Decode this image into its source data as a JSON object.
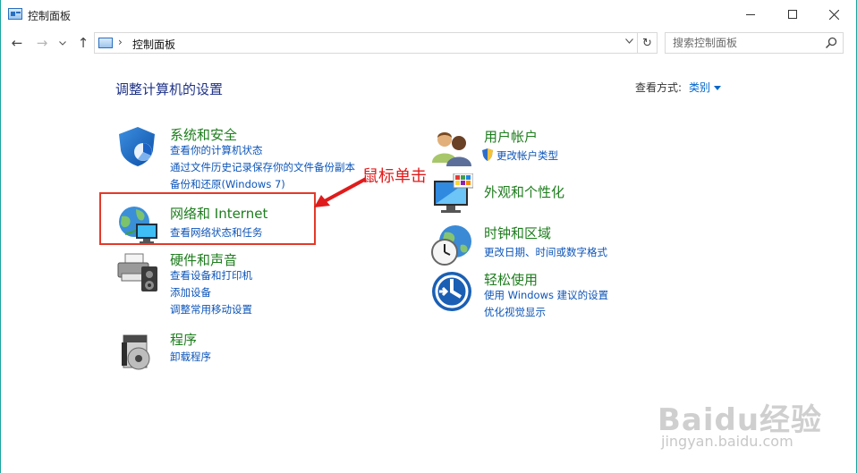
{
  "window": {
    "title": "控制面板"
  },
  "nav": {
    "back_glyph": "←",
    "forward_glyph": "→",
    "recent_glyph": "⌄",
    "up_glyph": "↑",
    "breadcrumb_sep": "›",
    "breadcrumb": "控制面板",
    "dropdown_glyph": "⌄",
    "refresh_glyph": "↻"
  },
  "search": {
    "placeholder": "搜索控制面板"
  },
  "main": {
    "heading": "调整计算机的设置",
    "view_by_label": "查看方式:",
    "view_by_value": "类别"
  },
  "categories": {
    "security": {
      "title": "系统和安全",
      "links": [
        "查看你的计算机状态",
        "通过文件历史记录保存你的文件备份副本",
        "备份和还原(Windows 7)"
      ]
    },
    "network": {
      "title": "网络和 Internet",
      "links": [
        "查看网络状态和任务"
      ]
    },
    "hardware": {
      "title": "硬件和声音",
      "links": [
        "查看设备和打印机",
        "添加设备",
        "调整常用移动设置"
      ]
    },
    "programs": {
      "title": "程序",
      "links": [
        "卸载程序"
      ]
    },
    "accounts": {
      "title": "用户帐户",
      "links": [
        "更改帐户类型"
      ]
    },
    "appearance": {
      "title": "外观和个性化",
      "links": []
    },
    "clock": {
      "title": "时钟和区域",
      "links": [
        "更改日期、时间或数字格式"
      ]
    },
    "ease": {
      "title": "轻松使用",
      "links": [
        "使用 Windows 建议的设置",
        "优化视觉显示"
      ]
    }
  },
  "annotation": {
    "text": "鼠标单击",
    "color": "#e01b1b"
  },
  "watermark": {
    "main": "Baidu经验",
    "sub": "jingyan.baidu.com"
  },
  "colors": {
    "category_title": "#1e7d1e",
    "link": "#0d55b8",
    "heading": "#1e3287"
  }
}
